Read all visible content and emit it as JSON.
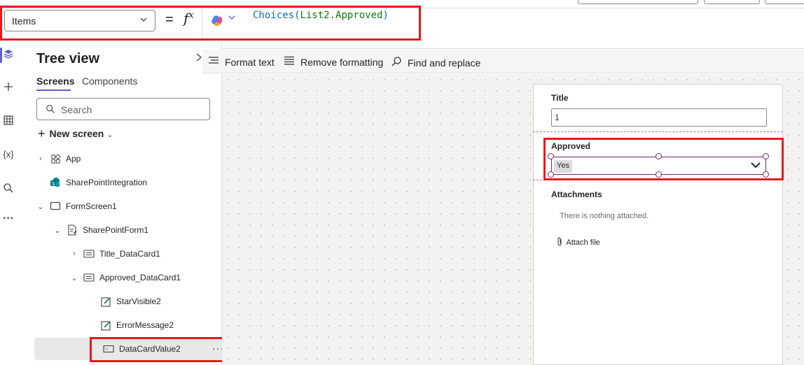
{
  "formula_bar": {
    "property": "Items",
    "equals": "=",
    "fx": "f",
    "fx_sup": "x",
    "formula_func": "Choices(",
    "formula_arg": "List2.Approved",
    "formula_close": ")"
  },
  "tree": {
    "title": "Tree view",
    "tabs": [
      "Screens",
      "Components"
    ],
    "search_placeholder": "Search",
    "new_screen": "New screen",
    "nodes": [
      "App",
      "SharePointIntegration",
      "FormScreen1",
      "SharePointForm1",
      "Title_DataCard1",
      "Approved_DataCard1",
      "StarVisible2",
      "ErrorMessage2",
      "DataCardValue2"
    ],
    "more": "···"
  },
  "toolbar": {
    "format_text": "Format text",
    "remove_formatting": "Remove formatting",
    "find_replace": "Find and replace"
  },
  "form": {
    "title_label": "Title",
    "title_value": "1",
    "approved_label": "Approved",
    "approved_value": "Yes",
    "attachments_label": "Attachments",
    "attachments_empty": "There is nothing attached.",
    "attach_file": "Attach file"
  },
  "colors": {
    "highlight_red": "#e8191c",
    "selection_purple": "#742774",
    "accent": "#5b5fc7"
  },
  "icons": [
    "layers-icon",
    "plus-icon",
    "table-icon",
    "variables-icon",
    "search-icon",
    "more-icon",
    "copilot-icon",
    "chevron-down-icon",
    "paperclip-icon"
  ]
}
